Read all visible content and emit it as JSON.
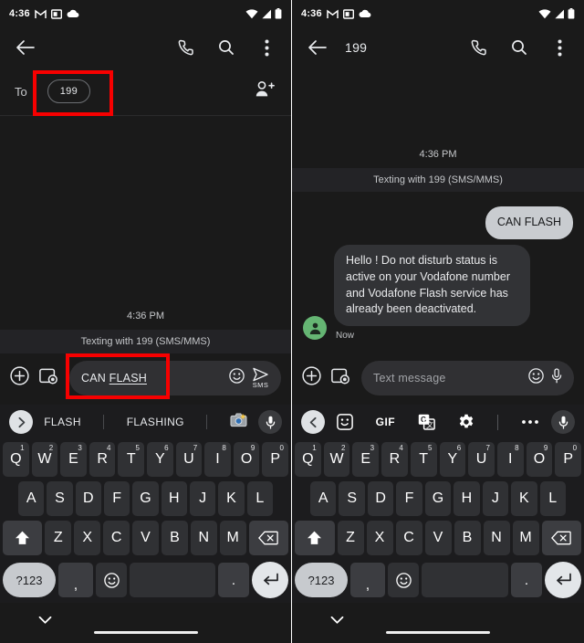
{
  "status_bar": {
    "time": "4:36",
    "left_icons": [
      "gmail-icon",
      "app-window-icon",
      "cloud-icon"
    ],
    "right_icons": [
      "wifi-icon",
      "signal-icon",
      "battery-icon"
    ]
  },
  "left_phone": {
    "app_bar": {
      "back": "back-arrow-icon",
      "call": "phone-icon",
      "search": "search-icon",
      "overflow": "more-vert-icon"
    },
    "recipient": {
      "to_label": "To",
      "chip_value": "199",
      "add_person_icon": "person-add-icon"
    },
    "conversation": {
      "time_divider": "4:36 PM",
      "banner": "Texting with 199 (SMS/MMS)"
    },
    "compose": {
      "plus_icon": "add-circle-icon",
      "gallery_icon": "gallery-camera-icon",
      "text_prefix": "CAN ",
      "text_spellcheck": "FLASH",
      "emoji_icon": "emoji-icon",
      "send_icon": "send-icon",
      "send_label": "SMS"
    },
    "keyboard": {
      "expand_icon": "chevron-right-icon",
      "suggestions": [
        "FLASH",
        "FLASHING"
      ],
      "emoji_suggestion": "camera-emoji",
      "mic_icon": "mic-icon"
    }
  },
  "right_phone": {
    "app_bar": {
      "back": "back-arrow-icon",
      "title": "199",
      "call": "phone-icon",
      "search": "search-icon",
      "overflow": "more-vert-icon"
    },
    "conversation": {
      "time_divider": "4:36 PM",
      "banner": "Texting with 199 (SMS/MMS)",
      "messages": [
        {
          "direction": "outgoing",
          "text": "CAN FLASH"
        },
        {
          "direction": "incoming",
          "text": "Hello ! Do not disturb status is  active on your Vodafone number and Vodafone Flash service has already been deactivated.",
          "stamp": "Now",
          "avatar": "person-avatar-icon",
          "avatar_color": "#65b573"
        }
      ]
    },
    "compose": {
      "plus_icon": "add-circle-icon",
      "gallery_icon": "gallery-camera-icon",
      "placeholder": "Text message",
      "emoji_icon": "emoji-icon",
      "mic_icon": "mic-icon"
    },
    "toolbar": {
      "collapse_icon": "chevron-left-icon",
      "sticker_icon": "sticker-icon",
      "gif_label": "GIF",
      "translate_icon": "translate-icon",
      "settings_icon": "gear-icon",
      "overflow_icon": "more-horiz-icon",
      "mic_icon": "mic-icon"
    }
  },
  "keyboard": {
    "row1": [
      {
        "key": "Q",
        "sup": "1"
      },
      {
        "key": "W",
        "sup": "2"
      },
      {
        "key": "E",
        "sup": "3"
      },
      {
        "key": "R",
        "sup": "4"
      },
      {
        "key": "T",
        "sup": "5"
      },
      {
        "key": "Y",
        "sup": "6"
      },
      {
        "key": "U",
        "sup": "7"
      },
      {
        "key": "I",
        "sup": "8"
      },
      {
        "key": "O",
        "sup": "9"
      },
      {
        "key": "P",
        "sup": "0"
      }
    ],
    "row2": [
      "A",
      "S",
      "D",
      "F",
      "G",
      "H",
      "J",
      "K",
      "L"
    ],
    "row3": [
      "Z",
      "X",
      "C",
      "V",
      "B",
      "N",
      "M"
    ],
    "shift_icon": "shift-icon",
    "backspace_icon": "backspace-icon",
    "row4": {
      "symbols": "?123",
      "comma": ",",
      "emoji_icon": "emoji-icon",
      "space": "",
      "period": ".",
      "enter_icon": "enter-icon"
    }
  },
  "nav_bar": {
    "chevron_icon": "chevron-down-icon",
    "home_pill": "home-indicator"
  },
  "annotations": {
    "highlight_color": "#f70000",
    "boxes": [
      {
        "target": "recipient-chip-199"
      },
      {
        "target": "compose-text-can-flash"
      }
    ]
  }
}
